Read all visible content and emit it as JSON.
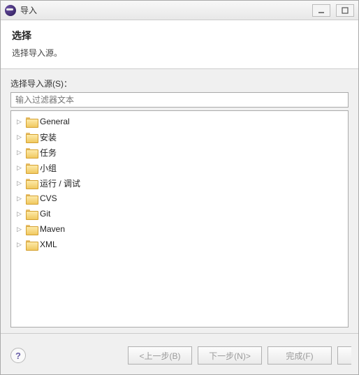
{
  "window": {
    "title": "导入"
  },
  "header": {
    "title": "选择",
    "subtitle": "选择导入源。"
  },
  "source": {
    "label": "选择导入源(S)：",
    "filter_placeholder": "输入过滤器文本"
  },
  "tree": {
    "items": [
      {
        "label": "General"
      },
      {
        "label": "安装"
      },
      {
        "label": "任务"
      },
      {
        "label": "小组"
      },
      {
        "label": "运行 / 调试"
      },
      {
        "label": "CVS"
      },
      {
        "label": "Git"
      },
      {
        "label": "Maven"
      },
      {
        "label": "XML"
      }
    ]
  },
  "footer": {
    "help": "?",
    "back": "<上一步(B)",
    "next": "下一步(N)>",
    "finish": "完成(F)"
  }
}
